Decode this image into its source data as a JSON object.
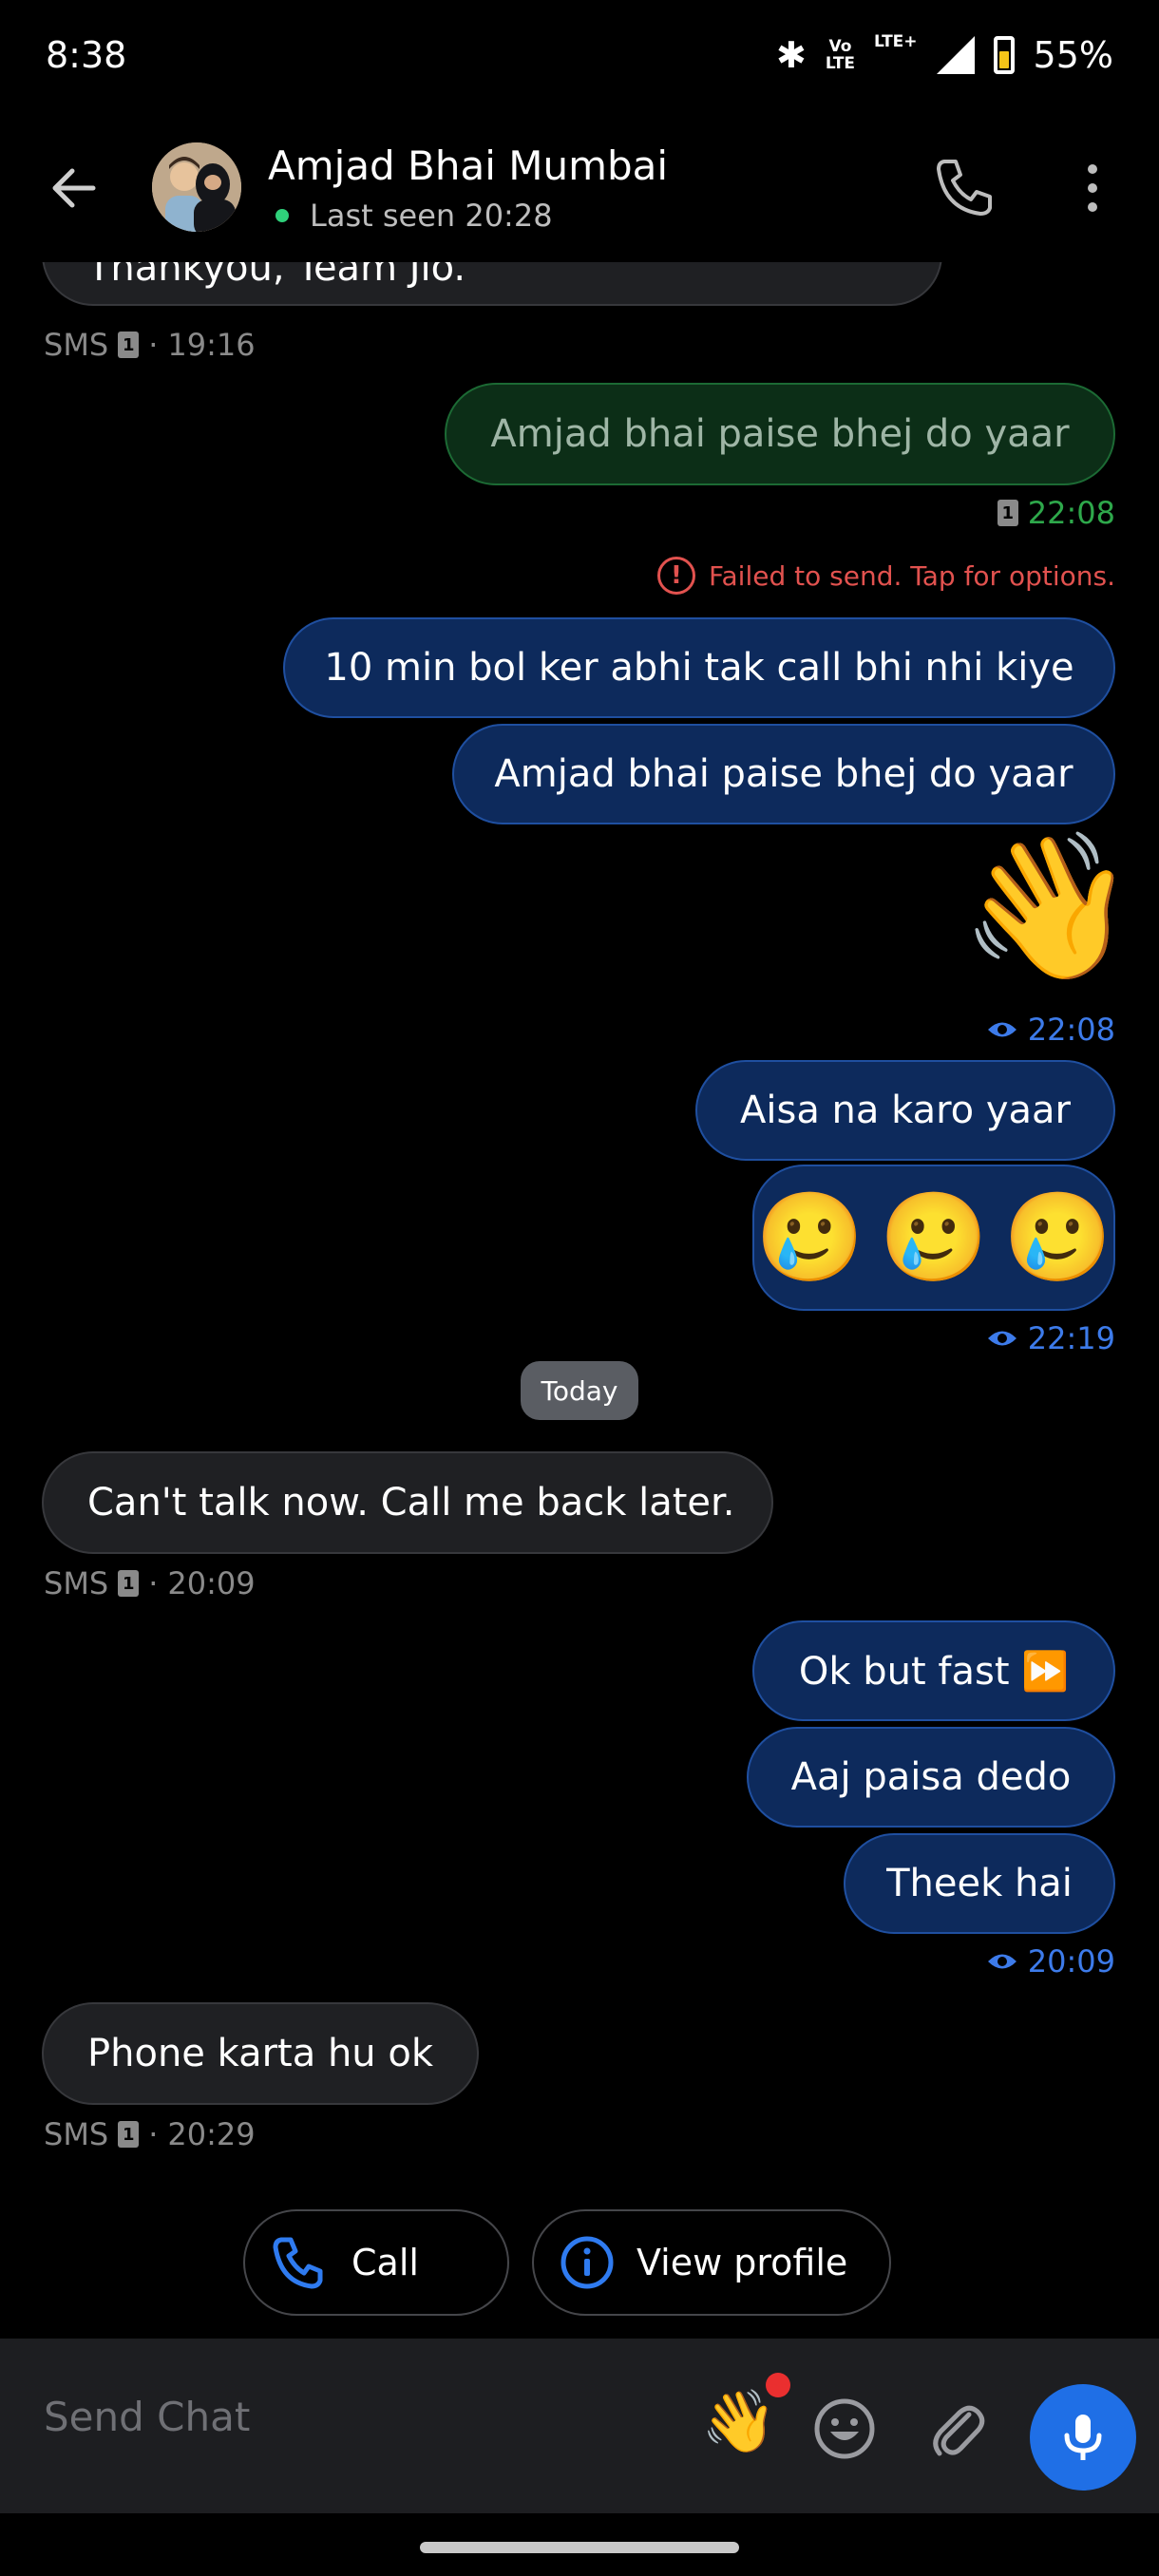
{
  "status_bar": {
    "time": "8:38",
    "volte": "Vo\nLTE",
    "lte": "LTE+",
    "battery_pct": "55%",
    "battery_level": 0.55
  },
  "header": {
    "contact_name": "Amjad Bhai Mumbai",
    "last_seen": "Last seen 20:28"
  },
  "messages": [
    {
      "id": "m0",
      "text": "Thankyou, Team Jio.",
      "meta_type": "SMS",
      "sim": "1",
      "time": "19:16"
    },
    {
      "id": "m1",
      "text": "Amjad bhai paise bhej do yaar",
      "sim": "1",
      "time": "22:08",
      "failed": "Failed to send. Tap for options."
    },
    {
      "id": "m2",
      "text": "10 min bol ker abhi tak call bhi nhi kiye"
    },
    {
      "id": "m3",
      "text": "Amjad bhai paise bhej do yaar"
    },
    {
      "id": "m4",
      "emoji": "👋",
      "time": "22:08"
    },
    {
      "id": "m5",
      "text": "Aisa na karo yaar"
    },
    {
      "id": "m6",
      "emojis": [
        "🥲",
        "🥲",
        "🥲"
      ],
      "time": "22:19"
    },
    {
      "id": "m7",
      "text": "Can't talk now. Call me back later.",
      "meta_type": "SMS",
      "sim": "1",
      "time": "20:09"
    },
    {
      "id": "m8",
      "text": "Ok but fast ⏩"
    },
    {
      "id": "m9",
      "text": "Aaj paisa dedo"
    },
    {
      "id": "m10",
      "text": "Theek hai",
      "time": "20:09"
    },
    {
      "id": "m11",
      "text": "Phone karta hu ok",
      "meta_type": "SMS",
      "sim": "1",
      "time": "20:29"
    }
  ],
  "day_divider": "Today",
  "actions": {
    "call_label": "Call",
    "profile_label": "View profile"
  },
  "composer": {
    "placeholder": "Send Chat",
    "wave_emoji": "👋"
  },
  "colors": {
    "outgoing_bubble": "#0d2a5c",
    "incoming_bubble": "#1f2023",
    "failed_bubble": "#0c2e17",
    "accent_blue": "#1f6fe6",
    "error_red": "#e2524f",
    "online_green": "#2fd07a"
  }
}
